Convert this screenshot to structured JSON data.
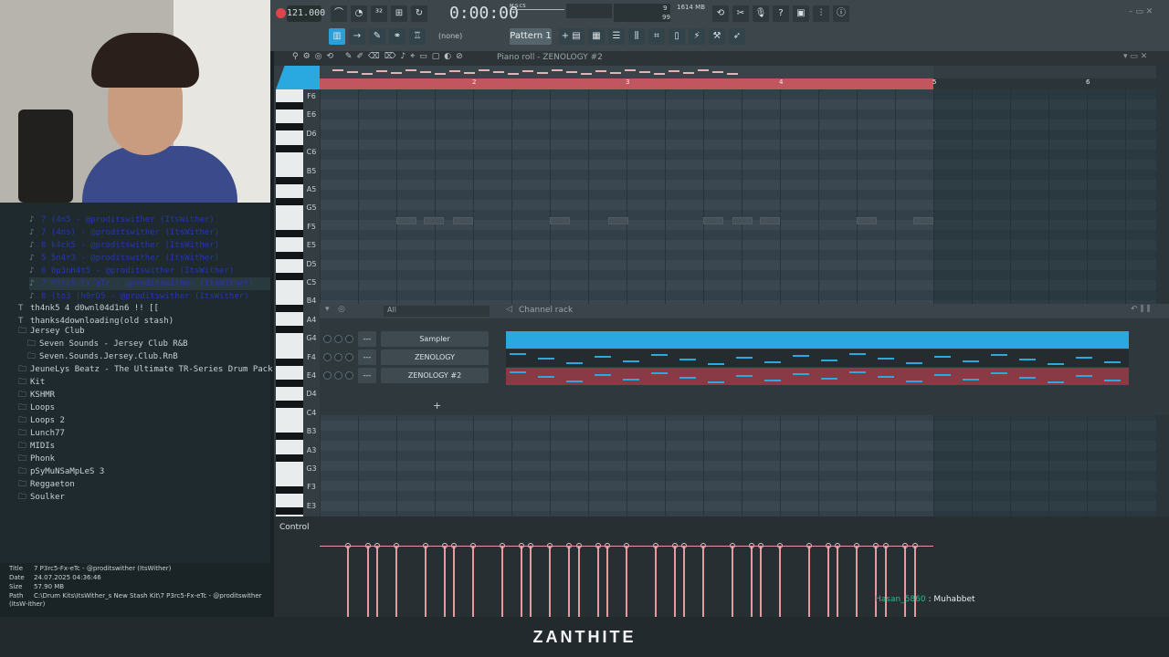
{
  "browser": {
    "files": [
      {
        "label": "7 (4n5 - @proditswither (ItsWither)",
        "dim": true
      },
      {
        "label": "7 (4ns) - @proditswither (ItsWither)",
        "dim": true
      },
      {
        "label": "8 k4ck5 - @proditswither (ItsWither)",
        "dim": true
      },
      {
        "label": "5 5n4r3 - @proditswither (ItsWither)",
        "dim": true
      },
      {
        "label": "6 0p3nH4t5 - @proditswither (ItsWither)",
        "dim": true
      },
      {
        "label": "7 P3rc5-Fx-eTc - @proditswither (ItsWither)",
        "dim": true,
        "sel": true
      },
      {
        "label": "8 (to3 (h0rD5 - @proditswither (ItsWither)",
        "dim": true
      },
      {
        "label": "th4nk5 4 d0wnl04d1n6 !! [[",
        "icon": "T"
      },
      {
        "label": "thanks4downloading(old stash)",
        "icon": "T"
      },
      {
        "label": "Jersey Club",
        "icon": "folder",
        "hdr": true
      },
      {
        "label": "Seven Sounds - Jersey Club R&B",
        "icon": "folder",
        "indent": true
      },
      {
        "label": "Seven.Sounds.Jersey.Club.RnB",
        "icon": "folder",
        "indent": true
      },
      {
        "label": "JeuneLys Beatz - The Ultimate TR-Series Drum Pack [Free]",
        "icon": "folder"
      },
      {
        "label": "Kit",
        "icon": "folder"
      },
      {
        "label": "KSHMR",
        "icon": "folder"
      },
      {
        "label": "Loops",
        "icon": "folder"
      },
      {
        "label": "Loops 2",
        "icon": "folder"
      },
      {
        "label": "Lunch77",
        "icon": "folder"
      },
      {
        "label": "MIDIs",
        "icon": "folder"
      },
      {
        "label": "Phonk",
        "icon": "folder"
      },
      {
        "label": "pSyMuNSaMpLeS 3",
        "icon": "folder"
      },
      {
        "label": "Reggaeton",
        "icon": "folder"
      },
      {
        "label": "Soulker",
        "icon": "folder"
      }
    ],
    "info": {
      "title_label": "Title",
      "title": "7 P3rc5-Fx-eTc - @proditswither (ItsWither)",
      "date_label": "Date",
      "date": "24.07.2025 04:36:46",
      "size_label": "Size",
      "size": "57.90 MB",
      "path_label": "Path",
      "path": "C:\\Drum Kits\\ItsWither_s New Stash Kit\\7 P3rc5-Fx-eTc - @proditswither (ItsW-ither)"
    }
  },
  "toolbar": {
    "bpm": "121.000",
    "time": "0:00:00",
    "time_unit": "M:S:CS",
    "cpu": "9",
    "memory": "1614 MB",
    "poly": "99",
    "preset": "(none)",
    "pattern": "Pattern 1"
  },
  "piano_roll": {
    "title": "Piano roll - ZENOLOGY #2",
    "bars": [
      "2",
      "3",
      "4",
      "5",
      "6"
    ],
    "keys_upper": [
      "F6",
      "E6",
      "D6",
      "C6",
      "B5",
      "A5",
      "G5",
      "F5",
      "E5",
      "D5",
      "C5",
      "B4",
      "A4",
      "G4",
      "F4",
      "E4",
      "D4",
      "C4",
      "B3",
      "A3",
      "G3",
      "F3",
      "E3"
    ]
  },
  "channel_rack": {
    "title": "Channel rack",
    "filter": "All",
    "channels": [
      {
        "name": "Sampler",
        "color": "#2aa8e0"
      },
      {
        "name": "ZENOLOGY",
        "color": "#252c30"
      },
      {
        "name": "ZENOLOGY #2",
        "color": "#8a3a44"
      }
    ],
    "add": "+"
  },
  "control": {
    "label": "Control"
  },
  "chat": {
    "user": "Hasan_5860",
    "message": "Muhabbet"
  },
  "caption": "ZANTHITE"
}
